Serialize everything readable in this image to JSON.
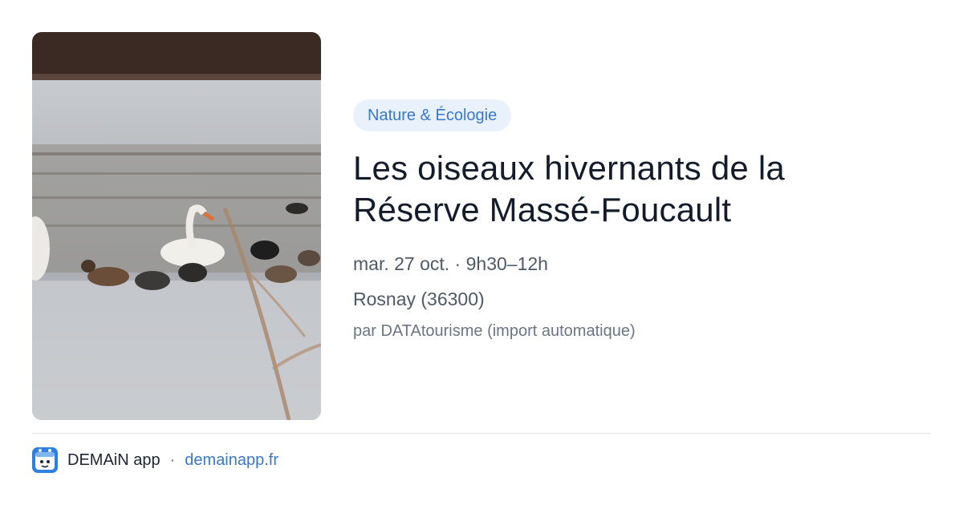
{
  "card": {
    "image_alt": "swan-and-ducks-photo",
    "category": "Nature & Écologie",
    "title_line1": "Les oiseaux hivernants de la",
    "title_line2": "Réserve Massé-Foucault",
    "datetime": "mar. 27 oct. · 9h30–12h",
    "location": "Rosnay (36300)",
    "source": "par DATAtourisme (import automatique)"
  },
  "footer": {
    "app_name": "DEMAiN app",
    "separator": "·",
    "site": "demainapp.fr",
    "icon": "app-logo-icon"
  },
  "colors": {
    "accent": "#3a78c9",
    "tag_bg": "#e9f1fc",
    "text": "#141c2b",
    "muted": "#4f5967"
  }
}
